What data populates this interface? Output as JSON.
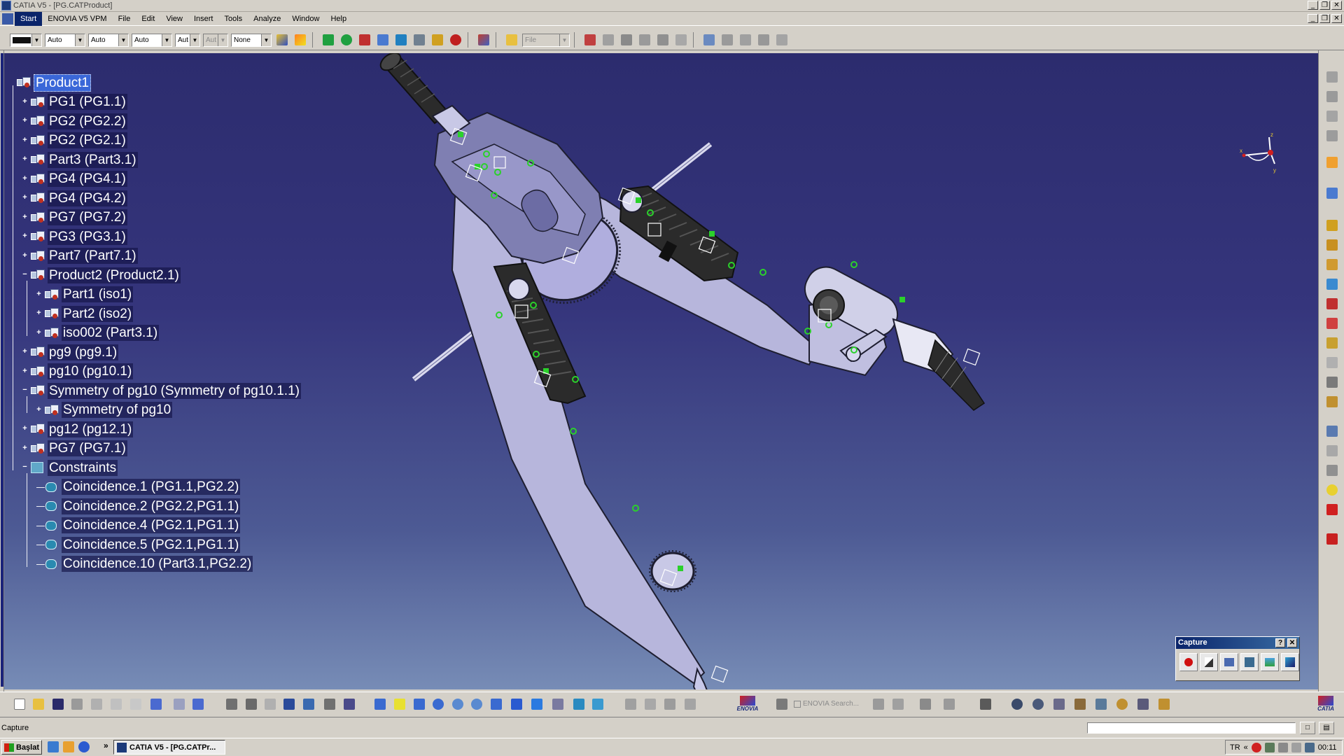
{
  "window": {
    "title": "CATIA V5 - [PG.CATProduct]",
    "controls": [
      "_",
      "❐",
      "✕"
    ]
  },
  "menu": {
    "items": [
      "Start",
      "ENOVIA V5 VPM",
      "File",
      "Edit",
      "View",
      "Insert",
      "Tools",
      "Analyze",
      "Window",
      "Help"
    ]
  },
  "toolbar": {
    "linetype_value": "",
    "thickness_value": "Auto",
    "pattern_value": "Auto",
    "color_value": "Auto",
    "layer_value": "Aut",
    "layer2_value": "Aut",
    "render_value": "None",
    "file_placeholder": "File"
  },
  "tree": {
    "nodes": [
      {
        "label": "Product1",
        "depth": 0,
        "expander": "none",
        "selected": true,
        "icon": "product-icon"
      },
      {
        "label": "PG1 (PG1.1)",
        "depth": 1,
        "expander": "plus",
        "icon": "part-icon"
      },
      {
        "label": "PG2 (PG2.2)",
        "depth": 1,
        "expander": "plus",
        "icon": "part-icon"
      },
      {
        "label": "PG2 (PG2.1)",
        "depth": 1,
        "expander": "plus",
        "icon": "part-icon"
      },
      {
        "label": "Part3 (Part3.1)",
        "depth": 1,
        "expander": "plus",
        "icon": "part-icon"
      },
      {
        "label": "PG4 (PG4.1)",
        "depth": 1,
        "expander": "plus",
        "icon": "part-icon"
      },
      {
        "label": "PG4 (PG4.2)",
        "depth": 1,
        "expander": "plus",
        "icon": "part-icon"
      },
      {
        "label": "PG7 (PG7.2)",
        "depth": 1,
        "expander": "plus",
        "icon": "part-icon"
      },
      {
        "label": "PG3 (PG3.1)",
        "depth": 1,
        "expander": "plus",
        "icon": "part-icon"
      },
      {
        "label": "Part7 (Part7.1)",
        "depth": 1,
        "expander": "plus",
        "icon": "part-icon"
      },
      {
        "label": "Product2 (Product2.1)",
        "depth": 1,
        "expander": "minus",
        "icon": "product-icon"
      },
      {
        "label": "Part1 (iso1)",
        "depth": 2,
        "expander": "plus",
        "icon": "part-icon"
      },
      {
        "label": "Part2 (iso2)",
        "depth": 2,
        "expander": "plus",
        "icon": "part-icon"
      },
      {
        "label": "iso002 (Part3.1)",
        "depth": 2,
        "expander": "plus",
        "icon": "part-icon"
      },
      {
        "label": "pg9 (pg9.1)",
        "depth": 1,
        "expander": "plus",
        "icon": "part-icon"
      },
      {
        "label": "pg10 (pg10.1)",
        "depth": 1,
        "expander": "plus",
        "icon": "part-icon"
      },
      {
        "label": "Symmetry of pg10 (Symmetry of pg10.1.1)",
        "depth": 1,
        "expander": "minus",
        "icon": "part-icon"
      },
      {
        "label": "Symmetry of pg10",
        "depth": 2,
        "expander": "plus",
        "icon": "symmetry-icon"
      },
      {
        "label": "pg12 (pg12.1)",
        "depth": 1,
        "expander": "plus",
        "icon": "part-icon"
      },
      {
        "label": "PG7 (PG7.1)",
        "depth": 1,
        "expander": "plus",
        "icon": "part-icon"
      },
      {
        "label": "Constraints",
        "depth": 1,
        "expander": "minus",
        "icon": "constraints-icon"
      },
      {
        "label": "Coincidence.1 (PG1.1,PG2.2)",
        "depth": 2,
        "expander": "none",
        "icon": "coincidence-icon"
      },
      {
        "label": "Coincidence.2 (PG2.2,PG1.1)",
        "depth": 2,
        "expander": "none",
        "icon": "coincidence-icon"
      },
      {
        "label": "Coincidence.4 (PG2.1,PG1.1)",
        "depth": 2,
        "expander": "none",
        "icon": "coincidence-icon"
      },
      {
        "label": "Coincidence.5 (PG2.1,PG1.1)",
        "depth": 2,
        "expander": "none",
        "icon": "coincidence-icon"
      },
      {
        "label": "Coincidence.10 (Part3.1,PG2.2)",
        "depth": 2,
        "expander": "none",
        "icon": "coincidence-icon"
      }
    ]
  },
  "compass": {
    "x_label": "x",
    "y_label": "y",
    "z_label": "z"
  },
  "capture_panel": {
    "title": "Capture",
    "help": "?",
    "close": "✕"
  },
  "bottom_toolbar": {
    "enovia_label": "ENOVIA",
    "enovia_search": "ENOVIA Search...",
    "catia_brand": "CATIA"
  },
  "status": {
    "text": "Capture"
  },
  "taskbar": {
    "start_label": "Başlat",
    "task_label": "CATIA V5 - [PG.CATPr...",
    "more_label": "»",
    "lang": "TR",
    "tray_more": "«",
    "clock": "00:11"
  },
  "colors": {
    "selection": "#3a67d8",
    "viewport_top": "#2c2c6e",
    "viewport_bottom": "#778cb6",
    "part_body": "#b7b6dc",
    "grip": "#2b2b2b",
    "constraint_marker": "#2bd12b"
  }
}
